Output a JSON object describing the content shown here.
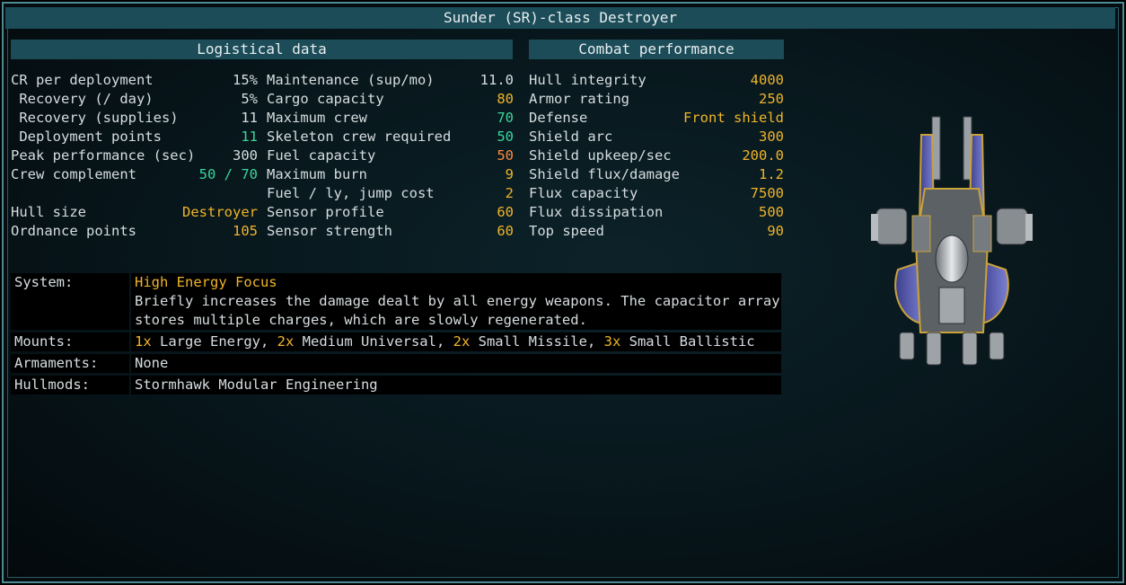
{
  "window": {
    "title": "Sunder (SR)-class Destroyer"
  },
  "logistics": {
    "header": "Logistical data",
    "left": [
      {
        "label": "CR per deployment",
        "value": "15%",
        "color": "white"
      },
      {
        "label": " Recovery (/ day)",
        "value": "5%",
        "color": "white"
      },
      {
        "label": " Recovery (supplies)",
        "value": "11",
        "color": "white"
      },
      {
        "label": " Deployment points",
        "value": "11",
        "color": "green"
      },
      {
        "label": "Peak performance (sec)",
        "value": "300",
        "color": "white"
      },
      {
        "label": "Crew complement",
        "value": "50 / 70",
        "color": "green"
      },
      {
        "label": "",
        "value": "",
        "color": "white"
      },
      {
        "label": "Hull size",
        "value": "Destroyer",
        "color": "gold"
      },
      {
        "label": "Ordnance points",
        "value": "105",
        "color": "gold"
      }
    ],
    "right": [
      {
        "label": "Maintenance (sup/mo)",
        "value": "11.0",
        "color": "white"
      },
      {
        "label": "Cargo capacity",
        "value": "80",
        "color": "gold"
      },
      {
        "label": "Maximum crew",
        "value": "70",
        "color": "green"
      },
      {
        "label": "Skeleton crew required",
        "value": "50",
        "color": "green"
      },
      {
        "label": "Fuel capacity",
        "value": "50",
        "color": "orange"
      },
      {
        "label": "Maximum burn",
        "value": "9",
        "color": "gold"
      },
      {
        "label": "Fuel / ly, jump cost",
        "value": "2",
        "color": "gold"
      },
      {
        "label": "Sensor profile",
        "value": "60",
        "color": "gold"
      },
      {
        "label": "Sensor strength",
        "value": "60",
        "color": "gold"
      }
    ]
  },
  "combat": {
    "header": "Combat performance",
    "rows": [
      {
        "label": "Hull integrity",
        "value": "4000",
        "color": "gold"
      },
      {
        "label": "Armor rating",
        "value": "250",
        "color": "gold"
      },
      {
        "label": "Defense",
        "value": "Front shield",
        "color": "gold"
      },
      {
        "label": "Shield arc",
        "value": "300",
        "color": "gold"
      },
      {
        "label": "Shield upkeep/sec",
        "value": "200.0",
        "color": "gold"
      },
      {
        "label": "Shield flux/damage",
        "value": "1.2",
        "color": "gold"
      },
      {
        "label": "Flux capacity",
        "value": "7500",
        "color": "gold"
      },
      {
        "label": "Flux dissipation",
        "value": "500",
        "color": "gold"
      },
      {
        "label": "Top speed",
        "value": "90",
        "color": "gold"
      }
    ]
  },
  "info": {
    "system_label": "System:",
    "system_name": "High Energy Focus",
    "system_desc_1": "Briefly increases the damage dealt by all energy weapons. The capacitor array",
    "system_desc_2": "stores multiple charges, which are slowly regenerated.",
    "mounts_label": "Mounts:",
    "mounts": [
      {
        "count": "1x",
        "name": " Large Energy, "
      },
      {
        "count": "2x",
        "name": " Medium Universal, "
      },
      {
        "count": "2x",
        "name": " Small Missile, "
      },
      {
        "count": "3x",
        "name": " Small Ballistic"
      }
    ],
    "armaments_label": "Armaments:",
    "armaments": "None",
    "hullmods_label": "Hullmods:",
    "hullmods": "Stormhawk Modular Engineering"
  },
  "colors": {
    "white": "#d6dde0",
    "gold": "#f0b429",
    "green": "#39d69a",
    "orange": "#ff8a3a",
    "header_bg": "#1b4c58",
    "frame": "#4d8a94"
  },
  "ship_icon": "destroyer-ship-sprite"
}
